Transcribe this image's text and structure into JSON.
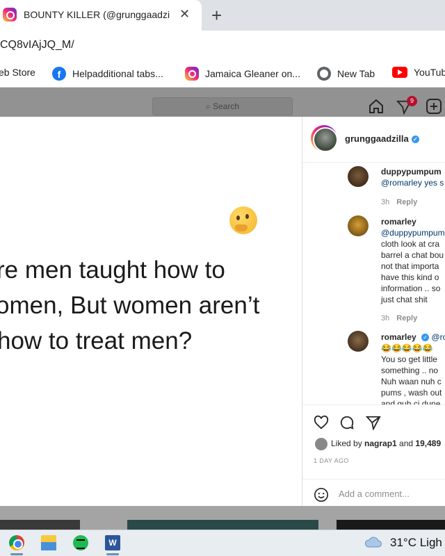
{
  "browser": {
    "tab_title": "BOUNTY KILLER (@grunggaadzilla",
    "tab_close": "✕",
    "new_tab": "+",
    "url": "CQ8vIAjJQ_M/"
  },
  "bookmarks": [
    {
      "label": "eb Store",
      "icon": "none"
    },
    {
      "label": "Helpadditional tabs...",
      "icon": "facebook-icon"
    },
    {
      "label": "Jamaica Gleaner on...",
      "icon": "instagram-icon"
    },
    {
      "label": "New Tab",
      "icon": "globe-icon"
    },
    {
      "label": "YouTub",
      "icon": "youtube-icon"
    }
  ],
  "header": {
    "search_placeholder": "Search",
    "notification_count": "9"
  },
  "post": {
    "lines": [
      "re men taught how to",
      "omen, But women aren’t",
      " how to treat men?"
    ],
    "emoji": "thinking-face"
  },
  "sidebar": {
    "username": "grunggaadzilla",
    "verified_mark": "✓",
    "comments": [
      {
        "name": "duppypumpum",
        "lines": [
          "@romarley yes s"
        ],
        "time": "3h",
        "reply": "Reply"
      },
      {
        "name": "romarley",
        "lines": [
          "@duppypumpum",
          "cloth look at cra",
          "barrel a chat bou",
          "not that importa",
          "have this kind o",
          "information .. so",
          "just chat shit"
        ],
        "time": "3h",
        "reply": "Reply"
      },
      {
        "name": "romarley",
        "mention": "@ro",
        "emojis": "😂😂😂😂😂",
        "lines": [
          "You so get little",
          "something .. no",
          "Nuh waan nuh c",
          "pums , wash out",
          "and gub ci dune"
        ]
      }
    ],
    "liked_prefix": "Liked by ",
    "liked_user": "nagrap1",
    "liked_and": " and ",
    "liked_count": "19,489",
    "posted_ago": "1 DAY AGO",
    "add_comment_placeholder": "Add a comment..."
  },
  "taskbar": {
    "word_letter": "W",
    "temperature": "31°C",
    "condition": "Ligh"
  },
  "colors": {
    "instagram_blue": "#3897f0",
    "notification_red": "#b3112f",
    "chrome_tabbar": "#dee1e6"
  }
}
